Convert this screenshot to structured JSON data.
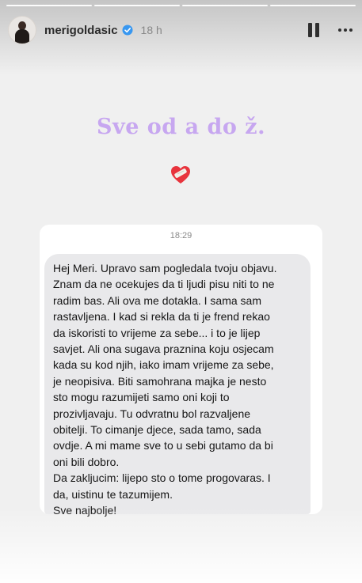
{
  "story": {
    "username": "merigoldasic",
    "time_ago": "18 h",
    "progress": {
      "segments": 4,
      "current": 4
    },
    "headline": "Sve od a do ž.",
    "sticker": "mending-heart-icon",
    "colors": {
      "headline": "#c7a7f0",
      "bubble": "#e9e9eb",
      "verified": "#3897f0"
    }
  },
  "message": {
    "timestamp": "18:29",
    "lines": [
      "Hej Meri. Upravo sam pogledala tvoju objavu.",
      "Znam da ne ocekujes da ti ljudi pisu niti to ne",
      "radim bas. Ali ova me dotakla. I sama sam",
      "rastavljena. I kad si rekla da ti je frend rekao",
      "da iskoristi to vrijeme za sebe... i to je lijep",
      "savjet. Ali ona sugava praznina koju osjecam",
      "kada su kod njih, iako imam vrijeme za sebe,",
      "je neopisiva. Biti samohrana majka je nesto",
      "sto mogu razumijeti samo oni koji to",
      "prozivljavaju. Tu odvratnu bol razvaljene",
      "obitelji. To cimanje djece, sada tamo, sada",
      "ovdje. A mi mame sve to u sebi gutamo da bi",
      "oni bili dobro.",
      "Da zakljucim: lijepo sto o tome progovaras. I",
      "da, uistinu te tazumijem.",
      "Sve najbolje!"
    ]
  }
}
